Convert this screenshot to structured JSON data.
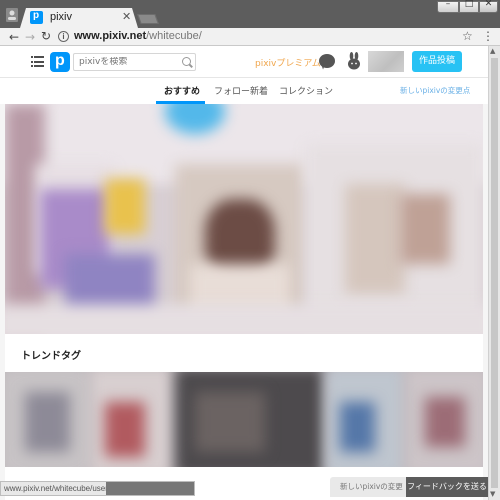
{
  "browser": {
    "tab_title": "pixiv",
    "tab_favicon_letter": "p",
    "url_host": "www.pixiv.net",
    "url_path": "/whitecube/",
    "status_url": "www.pixiv.net/whitecube/user"
  },
  "header": {
    "logo_letter": "p",
    "search_placeholder": "pixivを検索",
    "premium_label": "pixivプレミアム",
    "post_button_label": "作品投稿"
  },
  "subnav": {
    "tabs": [
      {
        "label": "おすすめ",
        "active": true
      },
      {
        "label": "フォロー新着",
        "active": false
      },
      {
        "label": "コレクション",
        "active": false
      }
    ],
    "changes_link": "新しいpixivの変更点"
  },
  "sections": {
    "trend_title": "トレンドタグ"
  },
  "footer": {
    "changes_link": "新しいpixivの変更点",
    "feedback_label": "フィードバックを送る"
  },
  "colors": {
    "accent": "#0096fa",
    "post_button": "#27c2f4",
    "premium": "#f0a64d"
  }
}
